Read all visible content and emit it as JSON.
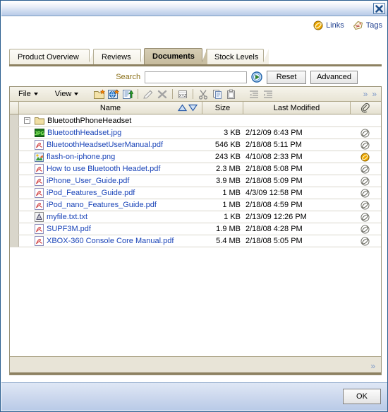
{
  "window": {
    "close_label": "Close",
    "accent": "#2a5d8f"
  },
  "header": {
    "links_label": "Links",
    "tags_label": "Tags"
  },
  "tabs": [
    {
      "label": "Product Overview",
      "active": false
    },
    {
      "label": "Reviews",
      "active": false
    },
    {
      "label": "Documents",
      "active": true
    },
    {
      "label": "Stock Levels",
      "active": false
    }
  ],
  "search": {
    "label": "Search",
    "value": "",
    "placeholder": "",
    "go_label": "Go",
    "reset_label": "Reset",
    "advanced_label": "Advanced"
  },
  "toolbar": {
    "file_label": "File",
    "view_label": "View",
    "icons": [
      "new-folder-icon",
      "new-link-icon",
      "new-document-icon",
      "edit-icon",
      "delete-icon",
      "rename-icon",
      "cut-icon",
      "copy-icon",
      "paste-icon",
      "outdent-icon",
      "indent-icon"
    ],
    "overflow_label": "»"
  },
  "table": {
    "columns": {
      "name": "Name",
      "size": "Size",
      "modified": "Last Modified",
      "attachment": "attachment-icon"
    },
    "folder": {
      "name": "BluetoothPhoneHeadset",
      "expanded": true,
      "expander_glyph": "−"
    },
    "rows": [
      {
        "name": "BluetoothHeadset.jpg",
        "type": "jpg",
        "size": "3 KB",
        "modified": "2/12/09 6:43 PM",
        "attachment": "plain"
      },
      {
        "name": "BluetoothHeadsetUserManual.pdf",
        "type": "pdf",
        "size": "546 KB",
        "modified": "2/18/08 5:11 PM",
        "attachment": "plain"
      },
      {
        "name": "flash-on-iphone.png",
        "type": "png",
        "size": "243 KB",
        "modified": "4/10/08 2:33 PM",
        "attachment": "gold"
      },
      {
        "name": "How to use Bluetooth Headet.pdf",
        "type": "pdf",
        "size": "2.3 MB",
        "modified": "2/18/08 5:08 PM",
        "attachment": "plain"
      },
      {
        "name": "iPhone_User_Guide.pdf",
        "type": "pdf",
        "size": "3.9 MB",
        "modified": "2/18/08 5:09 PM",
        "attachment": "plain"
      },
      {
        "name": "iPod_Features_Guide.pdf",
        "type": "pdf",
        "size": "1 MB",
        "modified": "4/3/09 12:58 PM",
        "attachment": "plain"
      },
      {
        "name": "iPod_nano_Features_Guide.pdf",
        "type": "pdf",
        "size": "1 MB",
        "modified": "2/18/08 4:59 PM",
        "attachment": "plain"
      },
      {
        "name": "myfile.txt.txt",
        "type": "txt",
        "size": "1 KB",
        "modified": "2/13/09 12:26 PM",
        "attachment": "plain"
      },
      {
        "name": "SUPF3M.pdf",
        "type": "pdf",
        "size": "1.9 MB",
        "modified": "2/18/08 4:28 PM",
        "attachment": "plain"
      },
      {
        "name": "XBOX-360 Console Core Manual.pdf",
        "type": "pdf",
        "size": "5.4 MB",
        "modified": "2/18/08 5:05 PM",
        "attachment": "plain"
      }
    ],
    "footer_overflow": "»"
  },
  "footer": {
    "ok_label": "OK"
  }
}
